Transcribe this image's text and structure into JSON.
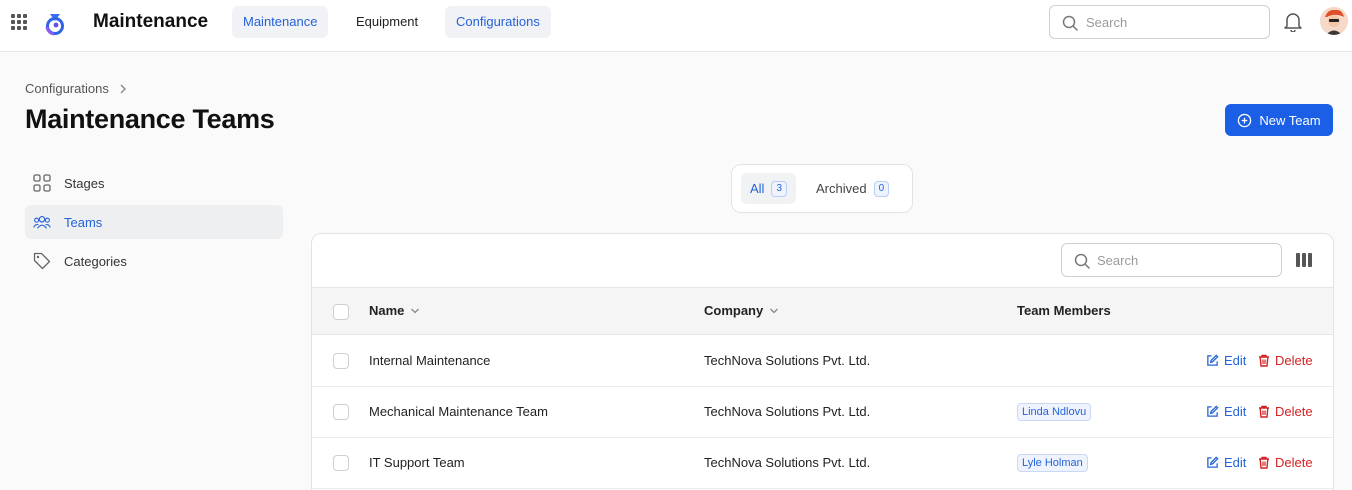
{
  "header": {
    "app_title": "Maintenance",
    "nav": [
      "Maintenance",
      "Equipment",
      "Configurations"
    ],
    "search_placeholder": "Search",
    "icons": {
      "apps": "apps-grid-icon",
      "logo": "app-logo-icon",
      "bell": "bell-icon",
      "avatar": "user-avatar"
    }
  },
  "breadcrumb": {
    "parent": "Configurations"
  },
  "page": {
    "title": "Maintenance Teams",
    "new_button": "New Team"
  },
  "sidebar": {
    "items": [
      {
        "label": "Stages",
        "icon": "grid-squares-icon",
        "active": false
      },
      {
        "label": "Teams",
        "icon": "users-icon",
        "active": true
      },
      {
        "label": "Categories",
        "icon": "tag-icon",
        "active": false
      }
    ]
  },
  "filters": {
    "all_label": "All",
    "all_count": "3",
    "archived_label": "Archived",
    "archived_count": "0"
  },
  "table": {
    "search_placeholder": "Search",
    "columns": [
      "Name",
      "Company",
      "Team Members"
    ],
    "edit_label": "Edit",
    "delete_label": "Delete",
    "rows": [
      {
        "name": "Internal Maintenance",
        "company": "TechNova Solutions Pvt. Ltd.",
        "members": ""
      },
      {
        "name": "Mechanical Maintenance Team",
        "company": "TechNova Solutions Pvt. Ltd.",
        "members": "Linda Ndlovu"
      },
      {
        "name": "IT Support Team",
        "company": "TechNova Solutions Pvt. Ltd.",
        "members": "Lyle Holman"
      }
    ]
  },
  "colors": {
    "accent": "#1b5fe6",
    "danger": "#d42222"
  }
}
